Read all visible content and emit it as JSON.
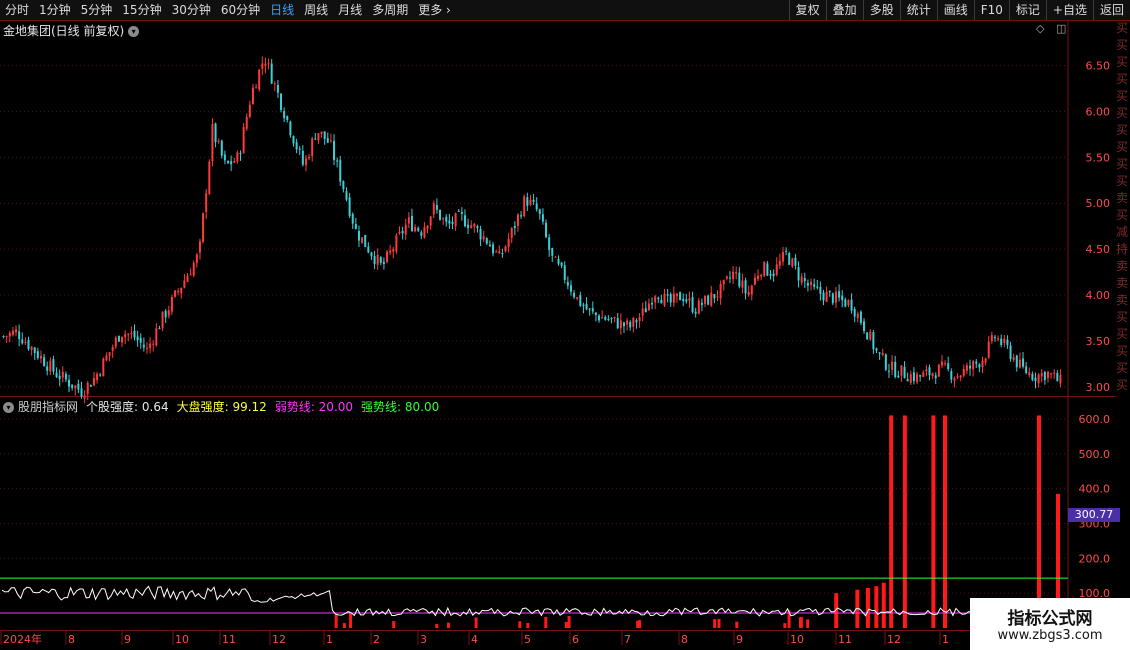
{
  "toolbar": {
    "periods": [
      "分时",
      "1分钟",
      "5分钟",
      "15分钟",
      "30分钟",
      "60分钟",
      "日线",
      "周线",
      "月线",
      "多周期",
      "更多"
    ],
    "active_period": "日线",
    "right": [
      "复权",
      "叠加",
      "多股",
      "统计",
      "画线",
      "F10",
      "标记",
      "+自选",
      "返回"
    ]
  },
  "main": {
    "title": "金地集团(日线 前复权)",
    "dropdown_icon": "chevron-down-icon",
    "controls": [
      "◇",
      "◫"
    ]
  },
  "indicator": {
    "name": "股朋指标网",
    "labels": [
      {
        "text": "个股强度: 0.64",
        "color": "#e6e6e6"
      },
      {
        "text": "大盘强度: 99.12",
        "color": "#ffff33"
      },
      {
        "text": "弱势线: 20.00",
        "color": "#ff33ff"
      },
      {
        "text": "强势线: 80.00",
        "color": "#33ff33"
      }
    ],
    "tag_value": "300.77"
  },
  "sidebar_text": "买买买买买买买买买买卖买减持卖卖卖买买买买买",
  "watermark": {
    "title": "指标公式网",
    "url": "www.zbgs3.com"
  },
  "colors": {
    "up": "#ff3b3b",
    "down": "#39d0d8",
    "grid": "#5a1010",
    "strong_line": "#33ff33",
    "weak_line": "#ff33ff",
    "strength_line": "#ffffff"
  },
  "chart_data": [
    {
      "type": "candlestick",
      "title": "金地集团(日线 前复权)",
      "y_ticks": [
        "6.50",
        "6.00",
        "5.50",
        "5.00",
        "4.50",
        "4.00",
        "3.50",
        "3.00"
      ],
      "ylim": [
        2.9,
        6.8
      ],
      "x_ticks": [
        "2024年",
        "8",
        "9",
        "10",
        "11",
        "12",
        "1",
        "2",
        "3",
        "4",
        "5",
        "6",
        "7",
        "8",
        "9",
        "10",
        "11",
        "12",
        "1"
      ],
      "close_path": [
        3.55,
        3.6,
        3.45,
        3.3,
        3.15,
        3.05,
        2.95,
        3.1,
        3.35,
        3.6,
        3.55,
        3.4,
        3.7,
        3.95,
        4.2,
        4.45,
        5.8,
        5.4,
        5.5,
        6.2,
        6.6,
        6.2,
        5.8,
        5.4,
        5.8,
        5.65,
        5.2,
        4.7,
        4.5,
        4.3,
        4.55,
        4.8,
        4.7,
        4.95,
        4.75,
        4.85,
        4.75,
        4.6,
        4.4,
        4.7,
        5.05,
        4.9,
        4.4,
        4.2,
        3.95,
        3.8,
        3.75,
        3.7,
        3.65,
        3.8,
        4.05,
        3.9,
        4.0,
        3.85,
        3.95,
        4.05,
        4.25,
        4.0,
        4.3,
        4.25,
        4.45,
        4.2,
        4.05,
        4.0,
        3.95,
        3.9,
        3.65,
        3.35,
        3.2,
        3.15,
        3.1,
        3.15,
        3.2,
        3.12,
        3.2,
        3.3,
        3.55,
        3.4,
        3.2,
        3.12,
        3.15,
        3.05
      ]
    },
    {
      "type": "bar+line",
      "title": "股朋指标网",
      "y_ticks": [
        "600.0",
        "500.0",
        "400.0",
        "300.0",
        "200.0",
        "100.0"
      ],
      "ylim": [
        0,
        640
      ],
      "strong_line": 80,
      "weak_line": 20,
      "big_bars": [
        {
          "x": 0.842,
          "value": 610
        },
        {
          "x": 0.855,
          "value": 610
        },
        {
          "x": 0.882,
          "value": 610
        },
        {
          "x": 0.893,
          "value": 610
        },
        {
          "x": 0.982,
          "value": 610
        },
        {
          "x": 1.0,
          "value": 385
        },
        {
          "x": 0.79,
          "value": 100
        },
        {
          "x": 0.81,
          "value": 110
        },
        {
          "x": 0.82,
          "value": 115
        },
        {
          "x": 0.828,
          "value": 120
        },
        {
          "x": 0.835,
          "value": 130
        }
      ]
    }
  ]
}
